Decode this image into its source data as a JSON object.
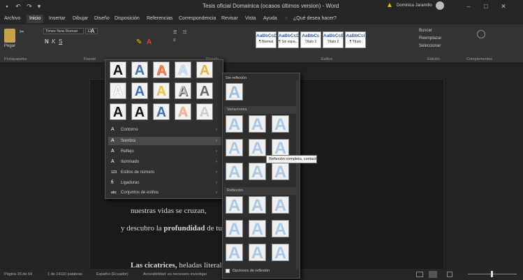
{
  "window": {
    "title": "Tesis oficial Domainica (ocasos últimos version) - Word",
    "user": "Dominica Jaramillo"
  },
  "tabs": [
    "Archivo",
    "Inicio",
    "Insertar",
    "Dibujar",
    "Diseño",
    "Disposición",
    "Referencias",
    "Correspondencia",
    "Revisar",
    "Vista",
    "Ayuda"
  ],
  "search": {
    "label": "¿Qué desea hacer?"
  },
  "ribbon": {
    "font_name": "Times New Roman",
    "font_size": "12",
    "clipboard": "Pegar",
    "groups": {
      "clipboard": "Portapapeles",
      "font": "Fuente",
      "paragraph": "Párrafo",
      "styles": "Estilos",
      "editing": "Edición",
      "addins": "Complementos"
    },
    "styles": [
      {
        "preview": "AaBbCcDc",
        "name": "¶ Normal"
      },
      {
        "preview": "AaBbCcDc",
        "name": "¶ Sin espa..."
      },
      {
        "preview": "AaBbCc",
        "name": "Título 1"
      },
      {
        "preview": "AaBbCcE",
        "name": "Título 2"
      },
      {
        "preview": "AaBbCcI",
        "name": "¶ Título"
      }
    ],
    "editing": [
      "Buscar",
      "Reemplazar",
      "Seleccionar"
    ]
  },
  "effects_menu": {
    "letters": [
      "A",
      "A",
      "A",
      "A",
      "A",
      "A",
      "A",
      "A",
      "A",
      "A",
      "A",
      "A",
      "A",
      "A",
      "A"
    ],
    "items": [
      {
        "icon": "A",
        "label": "Contorno"
      },
      {
        "icon": "A",
        "label": "Sombra"
      },
      {
        "icon": "A",
        "label": "Reflejo"
      },
      {
        "icon": "A",
        "label": "Iluminado"
      },
      {
        "icon": "123",
        "label": "Estilos de número"
      },
      {
        "icon": "fi",
        "label": "Ligaduras"
      },
      {
        "icon": "abc",
        "label": "Conjuntos de estilos"
      }
    ]
  },
  "reflection_menu": {
    "none_label": "Sin reflexión",
    "sec_variants": "Variaciones",
    "sec_other": "Reflexión",
    "tooltip": "Reflexión completa, contacto",
    "options_label": "Opciones de reflexión"
  },
  "document": {
    "line1": "nuestras vidas se cruzan,",
    "line2": "y descubro la",
    "line2_bold": "profundidad",
    "line2_end": "de tu",
    "line3_bold": "Las cicatrices,",
    "line3": "heladas literalmente"
  },
  "status": {
    "page": "Página 26 de 64",
    "words": "1 de 14110 palabras",
    "lang": "Español (Ecuador)",
    "accessibility": "Accesibilidad: es necesario investigar"
  },
  "colors": {
    "accent": "#2b579a",
    "warning": "#f0c000"
  }
}
